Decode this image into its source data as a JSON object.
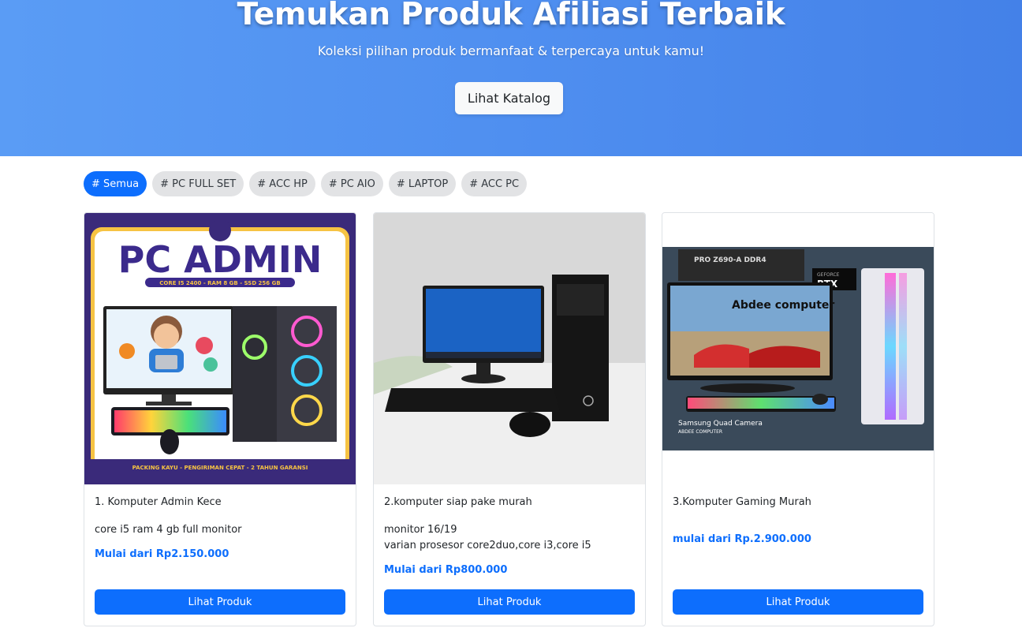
{
  "hero": {
    "title": "Temukan Produk Afiliasi Terbaik",
    "subtitle": "Koleksi pilihan produk bermanfaat & terpercaya untuk kamu!",
    "cta_label": "Lihat Katalog"
  },
  "filters": [
    {
      "label": "# Semua",
      "active": true
    },
    {
      "label": "# PC FULL SET",
      "active": false
    },
    {
      "label": "# ACC HP",
      "active": false
    },
    {
      "label": "# PC AIO",
      "active": false
    },
    {
      "label": "# LAPTOP",
      "active": false
    },
    {
      "label": "# ACC PC",
      "active": false
    }
  ],
  "products": [
    {
      "name": "1. Komputer Admin Kece",
      "desc": "core i5 ram 4 gb full monitor",
      "price": "Mulai dari Rp2.150.000",
      "button": "Lihat Produk",
      "image_text": {
        "heading": "PC ADMIN",
        "specs": "CORE I5 2400 - RAM 8 GB - SSD 256 GB",
        "footer": "PACKING KAYU  -  PENGIRIMAN CEPAT  -  2 TAHUN GARANSI"
      }
    },
    {
      "name": "2.komputer siap pake murah",
      "desc": "monitor 16/19",
      "desc2": "varian prosesor core2duo,core i3,core i5",
      "price": "Mulai dari Rp800.000",
      "button": "Lihat Produk"
    },
    {
      "name": "3.Komputer Gaming Murah",
      "desc": "",
      "price": "mulai dari Rp.2.900.000",
      "button": "Lihat Produk",
      "image_text": {
        "overlay": "Abdee computer",
        "gpu_label": "RTX",
        "brand_box": "GEFORCE",
        "board_label": "PRO Z690-A DDR4",
        "camera": "Samsung Quad Camera",
        "camera_sub": "ABDEE COMPUTER"
      }
    }
  ],
  "colors": {
    "primary": "#0d6efd",
    "hero_start": "#5a9cf5",
    "hero_end": "#4481e8",
    "chip_bg": "#e2e3e5"
  }
}
